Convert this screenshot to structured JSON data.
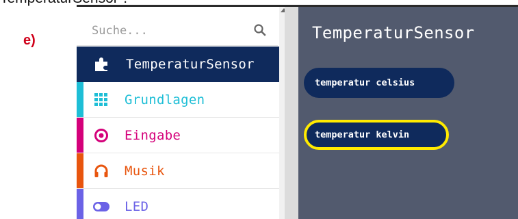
{
  "caption": "TemperaturSensor\".",
  "step_label": "e)",
  "search": {
    "placeholder": "Suche..."
  },
  "categories": [
    {
      "label": "TemperaturSensor",
      "color": "#0f2a5c",
      "icon": "puzzle-icon",
      "selected": true
    },
    {
      "label": "Grundlagen",
      "color": "#1ebed6",
      "icon": "grid-icon"
    },
    {
      "label": "Eingabe",
      "color": "#d4007a",
      "icon": "radio-target-icon"
    },
    {
      "label": "Musik",
      "color": "#e8550e",
      "icon": "headphones-icon"
    },
    {
      "label": "LED",
      "color": "#6b62e6",
      "icon": "toggle-icon"
    }
  ],
  "flyout": {
    "title": "TemperaturSensor",
    "blocks": [
      {
        "label": "temperatur celsius",
        "color": "#0f2a5c"
      },
      {
        "label": "temperatur kelvin",
        "color": "#0f2a5c",
        "highlight_color": "#ffea00"
      }
    ]
  }
}
